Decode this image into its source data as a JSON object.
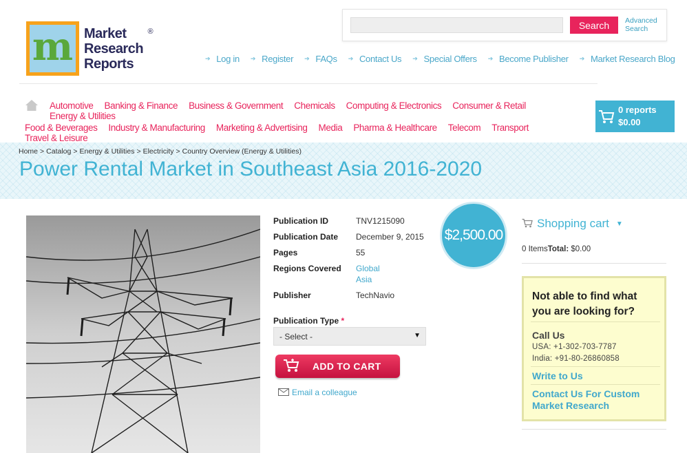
{
  "logo": {
    "mark_letter": "m",
    "line1": "Market",
    "line2": "Research",
    "line3": "Reports",
    "reg": "®"
  },
  "search": {
    "placeholder": "",
    "button": "Search",
    "advanced_line1": "Advanced",
    "advanced_line2": "Search"
  },
  "topnav": [
    "Log in",
    "Register",
    "FAQs",
    "Contact Us",
    "Special Offers",
    "Become Publisher",
    "Market Research Blog"
  ],
  "categories_row1": [
    "Automotive",
    "Banking & Finance",
    "Business & Government",
    "Chemicals",
    "Computing & Electronics",
    "Consumer & Retail",
    "Energy & Utilities"
  ],
  "categories_row2": [
    "Food & Beverages",
    "Industry & Manufacturing",
    "Marketing & Advertising",
    "Media",
    "Pharma & Healthcare",
    "Telecom",
    "Transport",
    "Travel & Leisure"
  ],
  "cart": {
    "count": "0 reports",
    "total": "$0.00"
  },
  "breadcrumb": [
    "Home",
    "Catalog",
    "Energy & Utilities",
    "Electricity",
    "Country Overview (Energy & Utilities)"
  ],
  "title": "Power Rental Market in Southeast Asia 2016-2020",
  "details": {
    "publication_id_label": "Publication ID",
    "publication_id": "TNV1215090",
    "publication_date_label": "Publication Date",
    "publication_date": "December 9, 2015",
    "pages_label": "Pages",
    "pages": "55",
    "regions_label": "Regions Covered",
    "region1": "Global",
    "region2": "Asia",
    "publisher_label": "Publisher",
    "publisher": "TechNavio"
  },
  "price": "$2,500.00",
  "publication_type": {
    "label": "Publication Type",
    "required": "*",
    "selected": "- Select -"
  },
  "add_to_cart": "ADD TO CART",
  "email_colleague": "Email a colleague",
  "sidebar": {
    "shopping_cart": "Shopping cart",
    "items": "0 Items",
    "total_label": "Total:",
    "total_value": "$0.00",
    "help_question": "Not able to find what you are looking for?",
    "call_us": "Call Us",
    "phone_usa": "USA: +1-302-703-7787",
    "phone_india": "India: +91-80-26860858",
    "write_to_us": "Write to Us",
    "contact_custom": "Contact Us For Custom Market Research"
  },
  "colors": {
    "accent_blue": "#41b3d3",
    "accent_pink": "#e8245c",
    "help_bg": "#fdfdcf"
  }
}
